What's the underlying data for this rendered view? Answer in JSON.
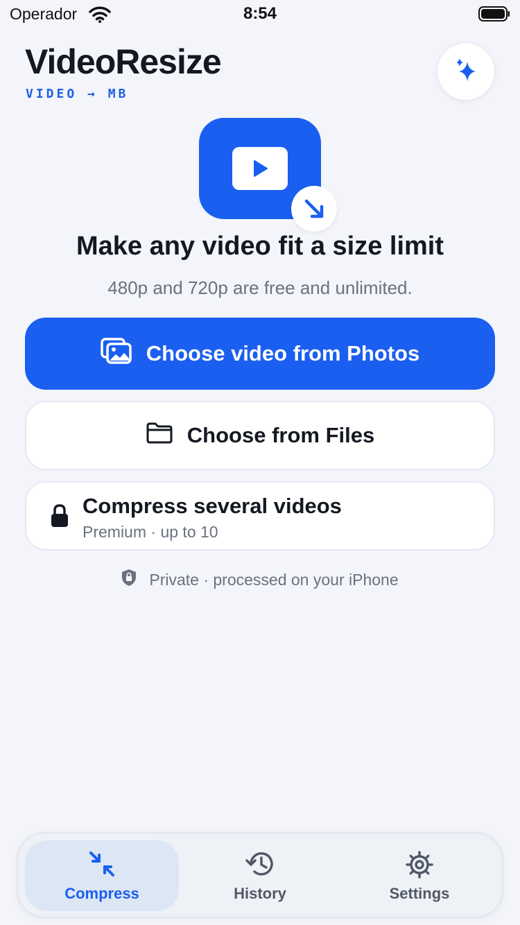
{
  "status_bar": {
    "carrier": "Operador",
    "time": "8:54"
  },
  "header": {
    "title": "VideoResize",
    "subtitle": "VIDEO → MB",
    "action_icon": "sparkles-icon"
  },
  "hero": {
    "headline": "Make any video fit a size limit",
    "tagline": "480p and 720p are free and unlimited."
  },
  "actions": {
    "photos_label": "Choose video from Photos",
    "files_label": "Choose from Files",
    "batch_title": "Compress several videos",
    "batch_subtitle": "Premium · up to 10"
  },
  "privacy_note": "Private · processed on your iPhone",
  "tabs": [
    {
      "label": "Compress",
      "icon": "compress-icon",
      "active": true
    },
    {
      "label": "History",
      "icon": "history-icon",
      "active": false
    },
    {
      "label": "Settings",
      "icon": "gear-icon",
      "active": false
    }
  ],
  "colors": {
    "accent": "#1a5ff0",
    "background": "#f3f5fa",
    "text": "#141821",
    "muted": "#6a7180"
  }
}
